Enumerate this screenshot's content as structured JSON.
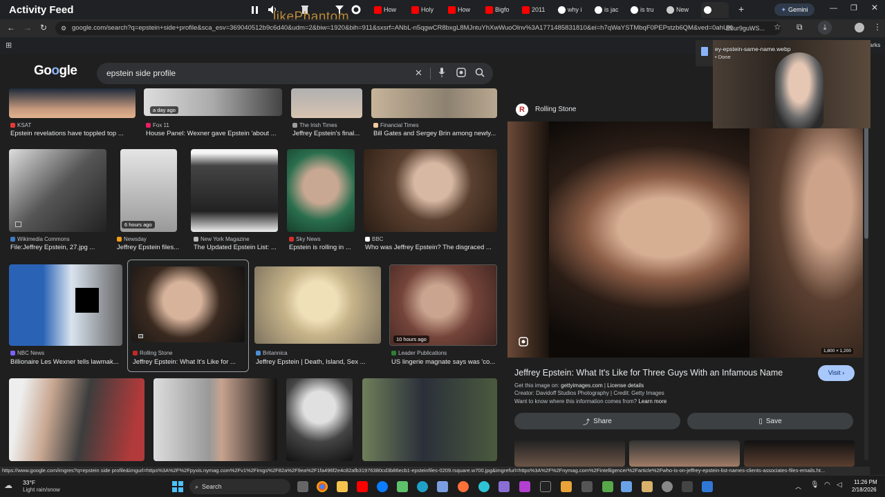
{
  "titlebar": {
    "app_title": "Activity Feed",
    "overlay_text": "likePhantom",
    "tabs": [
      {
        "label": "How",
        "color": "#ff0000"
      },
      {
        "label": "Holy",
        "color": "#ff0000"
      },
      {
        "label": "How",
        "color": "#ff0000"
      },
      {
        "label": "Bigfo",
        "color": "#ff0000"
      },
      {
        "label": "2011",
        "color": "#ff0000"
      },
      {
        "label": "why i",
        "color": "#ffffff"
      },
      {
        "label": "is jac",
        "color": "#ffffff"
      },
      {
        "label": "is tru",
        "color": "#ffffff"
      },
      {
        "label": "New",
        "color": "#dddddd"
      }
    ],
    "new_tab": "+",
    "gemini_label": "Gemini"
  },
  "address": {
    "url": "google.com/search?q=epstein+side+profile&sca_esv=369040512b9c6d40&udm=2&biw=1920&bih=911&sxsrf=ANbL-n5qgwCR8bxgL8MJntuYhXwWuoOlnv%3A1771485831810&ei=h7qWaYSTMbqF0PEPstzb6QM&ved=0ahUK",
    "url_tail": "E8ur9guWS...",
    "bookmarks_label": "All Bookmarks"
  },
  "download": {
    "filename": "ey-epstein-same-name.webp",
    "status": "Done"
  },
  "search": {
    "query": "epstein side profile"
  },
  "grid": {
    "row1": [
      {
        "source": "KSAT",
        "caption": "Epstein revelations have toppled top ...",
        "src_color": "#e53935"
      },
      {
        "source": "Fox 11",
        "caption": "House Panel: Wexner gave Epstein 'about ...",
        "src_color": "#e91e63",
        "ago": "a day ago"
      },
      {
        "source": "The Irish Times",
        "caption": "Jeffrey Epstein's final...",
        "src_color": "#9e9e9e"
      },
      {
        "source": "Financial Times",
        "caption": "Bill Gates and Sergey Brin among newly...",
        "src_color": "#f4c89e"
      }
    ],
    "row2": [
      {
        "source": "Wikimedia Commons",
        "caption": "File:Jeffrey Epstein, 27.jpg ...",
        "src_color": "#3f7ac2"
      },
      {
        "source": "Newsday",
        "caption": "Jeffrey Epstein files...",
        "src_color": "#f39c12",
        "ago": "6 hours ago"
      },
      {
        "source": "New York Magazine",
        "caption": "The Updated Epstein List: ...",
        "src_color": "#bbbbbb"
      },
      {
        "source": "Sky News",
        "caption": "Epstein is rolling in ...",
        "src_color": "#d32f2f"
      },
      {
        "source": "BBC",
        "caption": "Who was Jeffrey Epstein? The disgraced ...",
        "src_color": "#ffffff"
      }
    ],
    "row3": [
      {
        "source": "NBC News",
        "caption": "Billionaire Les Wexner tells lawmak...",
        "src_color": "#7b61ff"
      },
      {
        "source": "Rolling Stone",
        "caption": "Jeffrey Epstein: What It's Like for ...",
        "src_color": "#c62828"
      },
      {
        "source": "Britannica",
        "caption": "Jeffrey Epstein | Death, Island, Sex ...",
        "src_color": "#4a90d9"
      },
      {
        "source": "Leader Publications",
        "caption": "US lingerie magnate says was 'co...",
        "src_color": "#2e7d32",
        "ago": "10 hours ago"
      }
    ]
  },
  "panel": {
    "source": "Rolling Stone",
    "dimensions": "1,800 × 1,200",
    "title": "Jeffrey Epstein: What It's Like for Three Guys With an Infamous Name",
    "get_image_prefix": "Get this image on: ",
    "get_image_site": "gettyimages.com",
    "license": "License details",
    "creator": "Creator: Davidoff Studios Photography | Credit: Getty Images",
    "want_to_know": "Want to know where this information comes from? ",
    "learn_more": "Learn more",
    "visit": "Visit",
    "share": "Share",
    "save": "Save"
  },
  "status_url": "https://www.google.com/imgres?q=epstein side profile&imgurl=https%3A%2F%2Fpyxis.nymag.com%2Fv1%2Fimgs%2F82a%2F9ea%2F1fa496f2e4c82afb31976380cd3b86ecb1-epsteinfiles-0209.rsquare.w700.jpg&imgrefurl=https%3A%2F%2Fnymag.com%2Fintelligencer%2Farticle%2Fwho-is-on-jeffrey-epstein-list-names-clients-associates-files-emails.ht...",
  "taskbar": {
    "temp": "33°F",
    "weather": "Light rain/snow",
    "search_label": "Search",
    "time": "11:26 PM",
    "date": "2/18/2026"
  }
}
